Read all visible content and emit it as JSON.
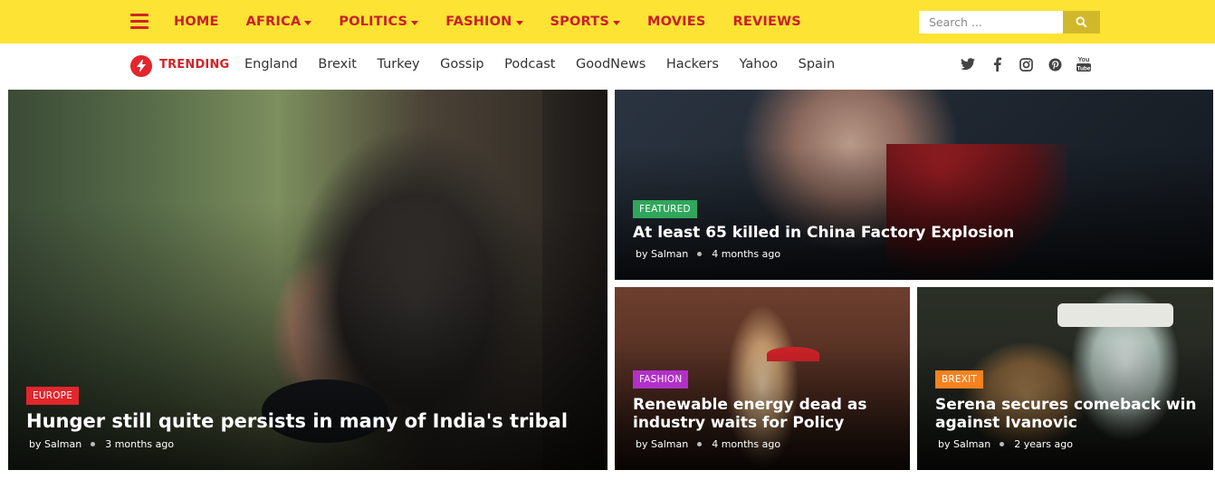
{
  "nav": {
    "items": [
      {
        "label": "HOME",
        "dropdown": false
      },
      {
        "label": "AFRICA",
        "dropdown": true
      },
      {
        "label": "POLITICS",
        "dropdown": true
      },
      {
        "label": "FASHION",
        "dropdown": true
      },
      {
        "label": "SPORTS",
        "dropdown": true
      },
      {
        "label": "MOVIES",
        "dropdown": false
      },
      {
        "label": "REVIEWS",
        "dropdown": false
      }
    ],
    "search": {
      "placeholder": "Search ...",
      "icon": "search-icon"
    },
    "menu_icon": "hamburger-menu-icon"
  },
  "trending": {
    "label": "TRENDING",
    "icon": "lightning-bolt-icon",
    "links": [
      "England",
      "Brexit",
      "Turkey",
      "Gossip",
      "Podcast",
      "GoodNews",
      "Hackers",
      "Yahoo",
      "Spain"
    ]
  },
  "social": [
    "twitter-icon",
    "facebook-icon",
    "instagram-icon",
    "pinterest-icon",
    "youtube-icon"
  ],
  "cards": {
    "hunger": {
      "category": "EUROPE",
      "category_color": "#e3262c",
      "title": "Hunger still quite persists in many of India's tribal",
      "author": "by Salman",
      "time": "3 months ago"
    },
    "china": {
      "category": "FEATURED",
      "category_color": "#2fa65b",
      "title": "At least 65 killed in China Factory Explosion",
      "author": "by Salman",
      "time": "4 months ago"
    },
    "renew": {
      "category": "FASHION",
      "category_color": "#b230c9",
      "title": "Renewable energy dead as industry waits for Policy",
      "author": "by Salman",
      "time": "4 months ago"
    },
    "serena": {
      "category": "BREXIT",
      "category_color": "#f4821f",
      "title": "Serena secures comeback win against Ivanovic",
      "author": "by Salman",
      "time": "2 years ago"
    }
  },
  "colors": {
    "topbar": "#fde333",
    "nav_text": "#c8202a",
    "accent": "#d2232a",
    "search_button": "#d1b82b"
  }
}
